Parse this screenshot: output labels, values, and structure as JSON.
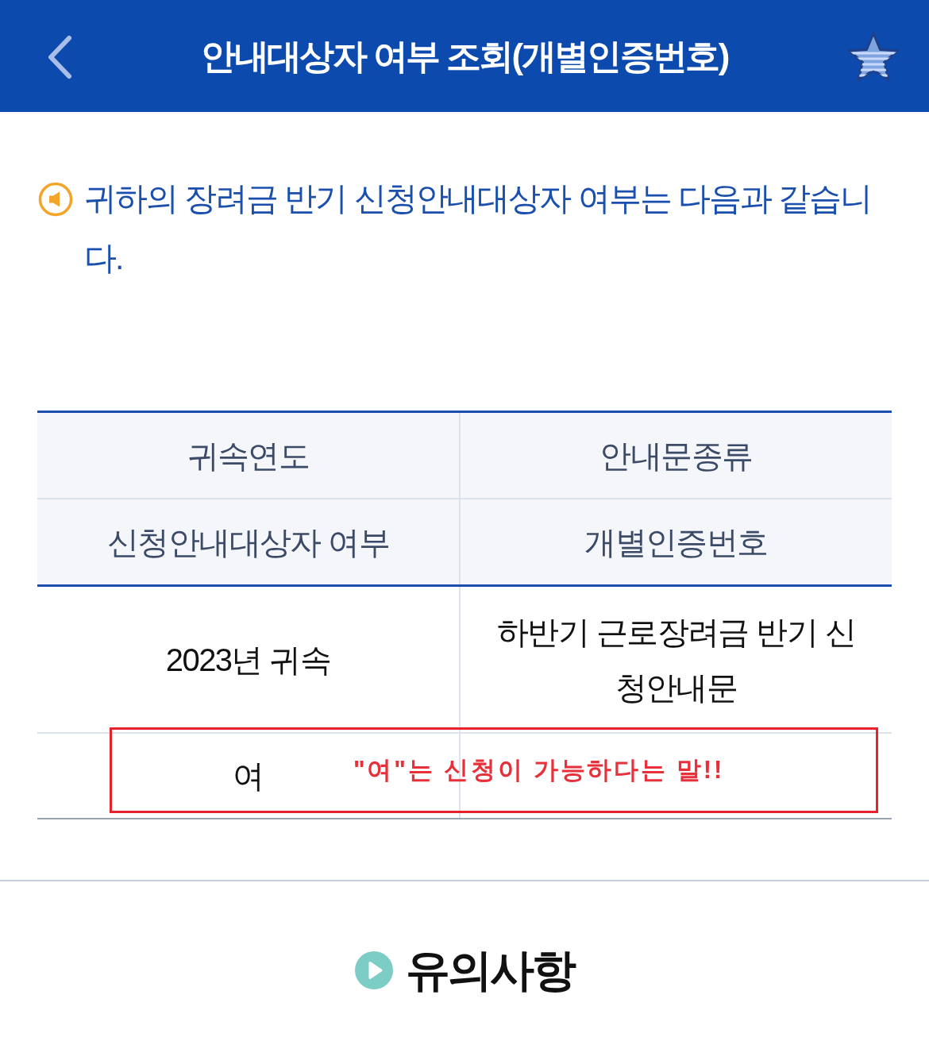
{
  "header": {
    "title": "안내대상자 여부 조회(개별인증번호)"
  },
  "notice": {
    "text": "귀하의 장려금 반기 신청안내대상자 여부는 다음과 같습니다."
  },
  "table": {
    "header_rows": [
      [
        "귀속연도",
        "안내문종류"
      ],
      [
        "신청안내대상자 여부",
        "개별인증번호"
      ]
    ],
    "body_rows": [
      [
        "2023년 귀속",
        "하반기 근로장려금 반기 신청안내문"
      ],
      [
        "여"
      ]
    ]
  },
  "annotation": {
    "text": "\"여\"는 신청이 가능하다는 말!!"
  },
  "section": {
    "title": "유의사항"
  }
}
